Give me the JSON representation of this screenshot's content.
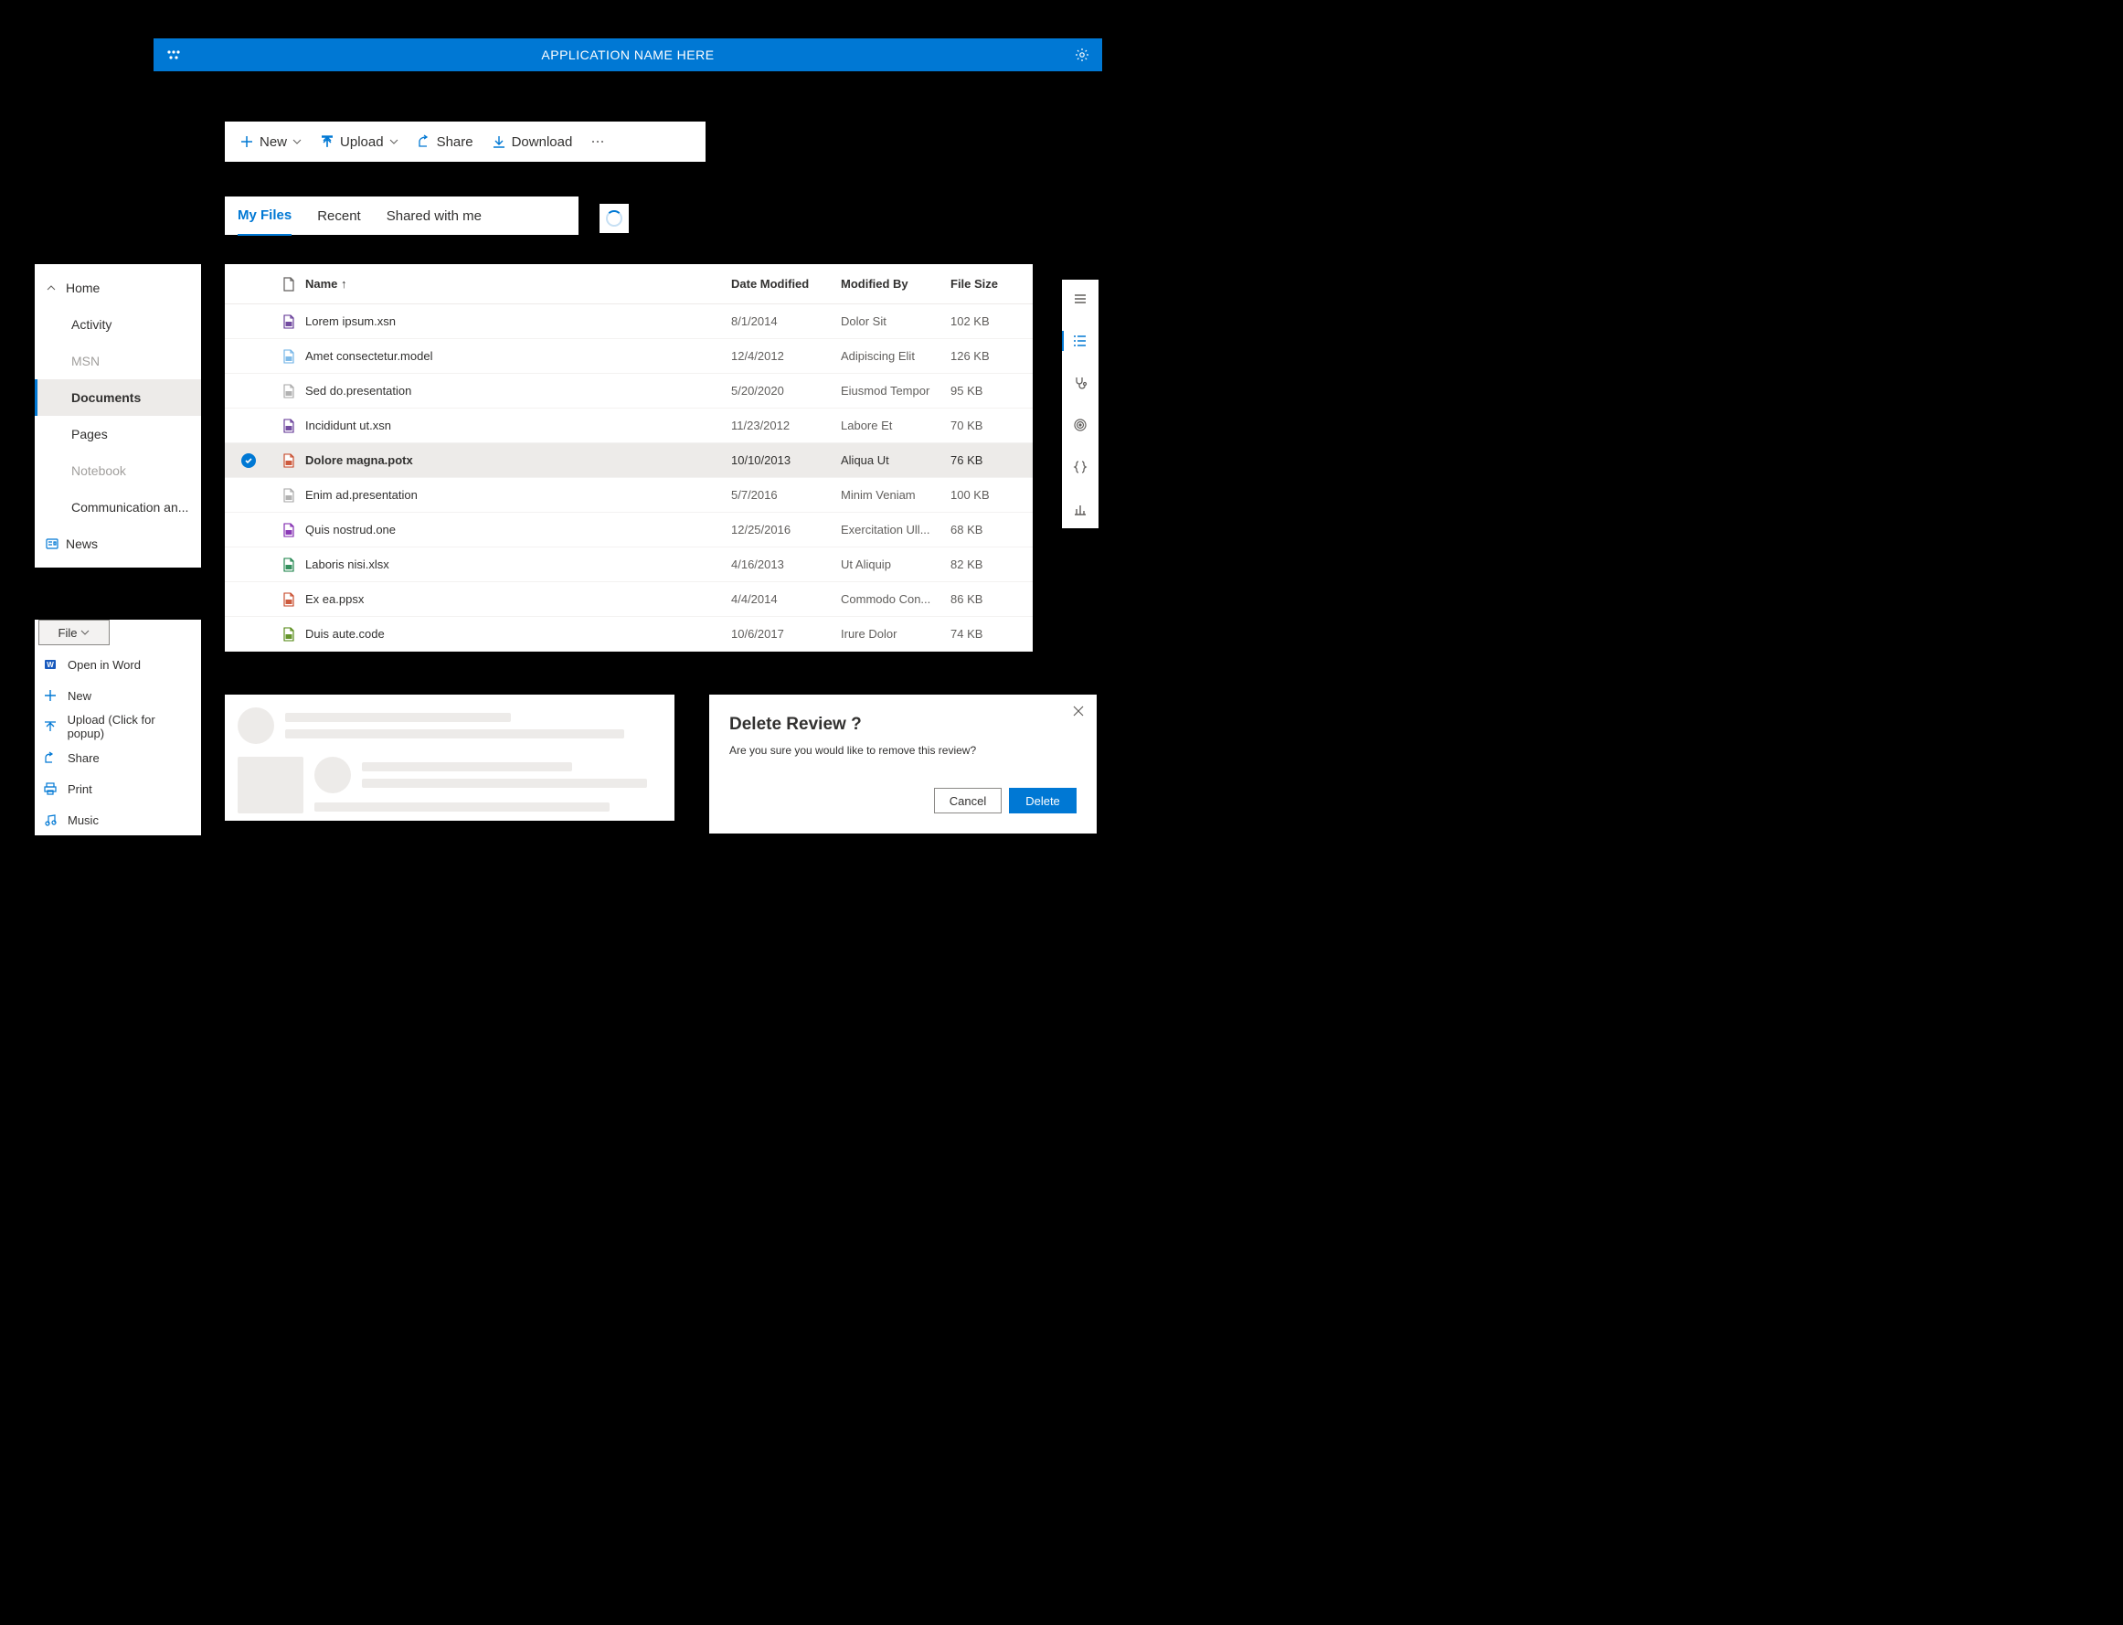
{
  "app_header": {
    "title": "APPLICATION NAME HERE"
  },
  "command_bar": {
    "new_label": "New",
    "upload_label": "Upload",
    "share_label": "Share",
    "download_label": "Download"
  },
  "tabs": {
    "items": [
      {
        "label": "My Files",
        "active": true
      },
      {
        "label": "Recent",
        "active": false
      },
      {
        "label": "Shared with me",
        "active": false
      }
    ]
  },
  "nav": {
    "home_label": "Home",
    "items": [
      {
        "label": "Activity",
        "disabled": false
      },
      {
        "label": "MSN",
        "disabled": true
      },
      {
        "label": "Documents",
        "selected": true
      },
      {
        "label": "Pages",
        "disabled": false
      },
      {
        "label": "Notebook",
        "disabled": true
      },
      {
        "label": "Communication an...",
        "disabled": false
      }
    ],
    "news_label": "News"
  },
  "file_list": {
    "columns": {
      "name": "Name",
      "sort_indicator": "↑",
      "date_modified": "Date Modified",
      "modified_by": "Modified By",
      "file_size": "File Size"
    },
    "rows": [
      {
        "icon": "infopath",
        "name": "Lorem ipsum.xsn",
        "date": "8/1/2014",
        "modby": "Dolor Sit",
        "size": "102 KB"
      },
      {
        "icon": "model",
        "name": "Amet consectetur.model",
        "date": "12/4/2012",
        "modby": "Adipiscing Elit",
        "size": "126 KB"
      },
      {
        "icon": "presentation",
        "name": "Sed do.presentation",
        "date": "5/20/2020",
        "modby": "Eiusmod Tempor",
        "size": "95 KB"
      },
      {
        "icon": "infopath",
        "name": "Incididunt ut.xsn",
        "date": "11/23/2012",
        "modby": "Labore Et",
        "size": "70 KB"
      },
      {
        "icon": "powerpoint",
        "name": "Dolore magna.potx",
        "date": "10/10/2013",
        "modby": "Aliqua Ut",
        "size": "76 KB",
        "selected": true
      },
      {
        "icon": "presentation",
        "name": "Enim ad.presentation",
        "date": "5/7/2016",
        "modby": "Minim Veniam",
        "size": "100 KB"
      },
      {
        "icon": "onenote",
        "name": "Quis nostrud.one",
        "date": "12/25/2016",
        "modby": "Exercitation Ull...",
        "size": "68 KB"
      },
      {
        "icon": "excel",
        "name": "Laboris nisi.xlsx",
        "date": "4/16/2013",
        "modby": "Ut Aliquip",
        "size": "82 KB"
      },
      {
        "icon": "ppsx",
        "name": "Ex ea.ppsx",
        "date": "4/4/2014",
        "modby": "Commodo Con...",
        "size": "86 KB"
      },
      {
        "icon": "code",
        "name": "Duis aute.code",
        "date": "10/6/2017",
        "modby": "Irure Dolor",
        "size": "74 KB"
      }
    ]
  },
  "icon_rail": {
    "items": [
      {
        "name": "collapse-menu-icon"
      },
      {
        "name": "list-view-icon",
        "active": true
      },
      {
        "name": "stethoscope-icon"
      },
      {
        "name": "radar-icon"
      },
      {
        "name": "braces-icon"
      },
      {
        "name": "bar-chart-icon"
      }
    ]
  },
  "file_menu": {
    "button_label": "File",
    "items": [
      {
        "icon": "word-icon",
        "label": "Open in Word"
      },
      {
        "icon": "plus-icon",
        "label": "New"
      },
      {
        "icon": "upload-icon",
        "label": "Upload (Click for popup)"
      },
      {
        "icon": "share-icon",
        "label": "Share"
      },
      {
        "icon": "print-icon",
        "label": "Print"
      },
      {
        "icon": "music-icon",
        "label": "Music"
      }
    ]
  },
  "dialog": {
    "title": "Delete Review ?",
    "body": "Are you sure you would like to remove this review?",
    "cancel_label": "Cancel",
    "confirm_label": "Delete"
  },
  "colors": {
    "primary": "#0078d4",
    "neutral_light": "#edebe9",
    "text_secondary": "#605e5c",
    "text_disabled": "#a19f9d"
  }
}
